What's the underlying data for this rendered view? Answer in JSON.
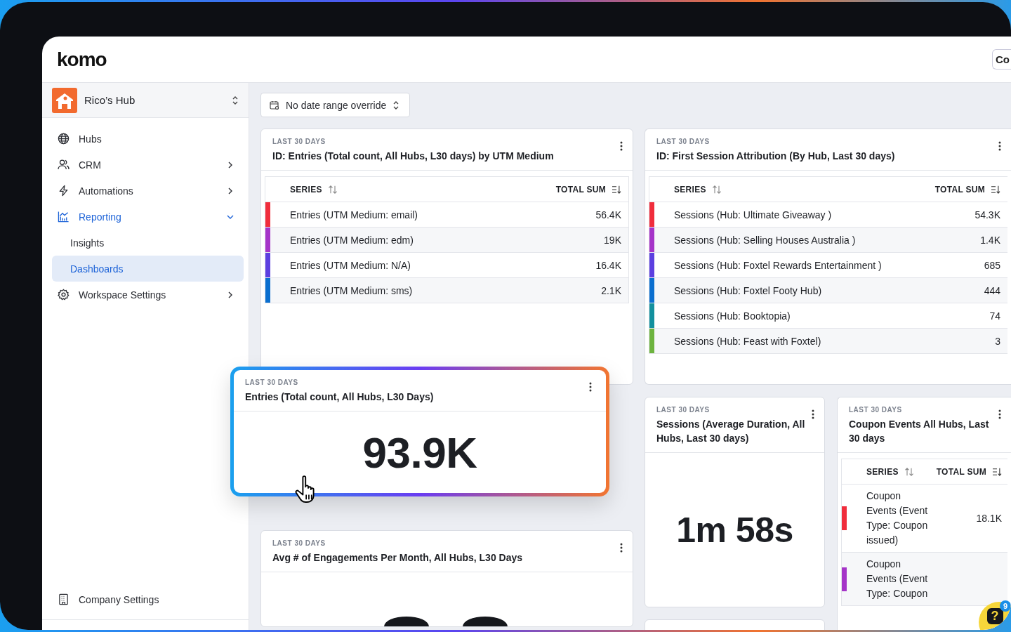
{
  "header": {
    "logo": "komo",
    "button": {
      "label": "Co"
    }
  },
  "workspace": {
    "name": "Rico’s Hub"
  },
  "nav": [
    {
      "label": "Hubs",
      "selected": false
    },
    {
      "label": "CRM",
      "selected": false,
      "expanded": false
    },
    {
      "label": "Automations",
      "selected": false,
      "expanded": false
    },
    {
      "label": "Reporting",
      "selected": false,
      "expanded": true,
      "children": [
        {
          "label": "Insights",
          "selected": false
        },
        {
          "label": "Dashboards",
          "selected": true
        }
      ]
    },
    {
      "label": "Workspace Settings",
      "selected": false,
      "expanded": false
    }
  ],
  "footer_nav": [
    {
      "label": "Company Settings",
      "selected": false
    }
  ],
  "date_filter": {
    "label": "No date range override"
  },
  "cards": [
    {
      "kind": "table",
      "period": "LAST 30 DAYS",
      "title": "ID: Entries (Total count, All Hubs, L30 days) by UTM Medium",
      "dragging": false,
      "columns": [
        "SERIES",
        "TOTAL SUM"
      ],
      "rows": [
        {
          "series": "Entries (UTM Medium: email)",
          "total": "56.4K",
          "color": "#f02d3c"
        },
        {
          "series": "Entries (UTM Medium: edm)",
          "total": "19K",
          "color": "#a534c8"
        },
        {
          "series": "Entries (UTM Medium: N/A)",
          "total": "16.4K",
          "color": "#5c3fe0"
        },
        {
          "series": "Entries (UTM Medium: sms)",
          "total": "2.1K",
          "color": "#0b6fcf"
        }
      ]
    },
    {
      "kind": "table",
      "period": "LAST 30 DAYS",
      "title": "ID: First Session Attribution (By Hub, Last 30 days)",
      "dragging": false,
      "columns": [
        "SERIES",
        "TOTAL SUM"
      ],
      "rows": [
        {
          "series": "Sessions (Hub: Ultimate Giveaway )",
          "total": "54.3K",
          "color": "#f02d3c"
        },
        {
          "series": "Sessions (Hub: Selling Houses Australia )",
          "total": "1.4K",
          "color": "#a534c8"
        },
        {
          "series": "Sessions (Hub: Foxtel Rewards Entertainment )",
          "total": "685",
          "color": "#5c3fe0"
        },
        {
          "series": "Sessions (Hub: Foxtel Footy Hub)",
          "total": "444",
          "color": "#0b6fcf"
        },
        {
          "series": "Sessions (Hub: Booktopia)",
          "total": "74",
          "color": "#13909e"
        },
        {
          "series": "Sessions (Hub: Feast with Foxtel)",
          "total": "3",
          "color": "#6db33f"
        }
      ]
    },
    {
      "kind": "number",
      "period": "LAST 30 DAYS",
      "title": "Entries (Total count, All Hubs, L30 Days)",
      "dragging": true,
      "value": "93.9K"
    },
    {
      "kind": "number",
      "period": "LAST 30 DAYS",
      "title": "Sessions (Average Duration, All Hubs, Last 30 days)",
      "dragging": false,
      "value": "1m 58s"
    },
    {
      "kind": "table",
      "period": "LAST 30 DAYS",
      "title": "Coupon Events All Hubs, Last 30 days",
      "dragging": false,
      "columns": [
        "SERIES",
        "TOTAL SUM"
      ],
      "rows": [
        {
          "series": "Coupon Events (Event Type: Coupon issued)",
          "total": "18.1K",
          "color": "#f02d3c"
        },
        {
          "series": "Coupon Events (Event Type: Coupon",
          "color": "#a534c8"
        }
      ]
    },
    {
      "kind": "number",
      "period": "LAST 30 DAYS",
      "title": "Avg # of Engagements Per Month, All Hubs, L30 Days",
      "dragging": false
    }
  ],
  "help": {
    "label": "?",
    "badge": "9"
  }
}
